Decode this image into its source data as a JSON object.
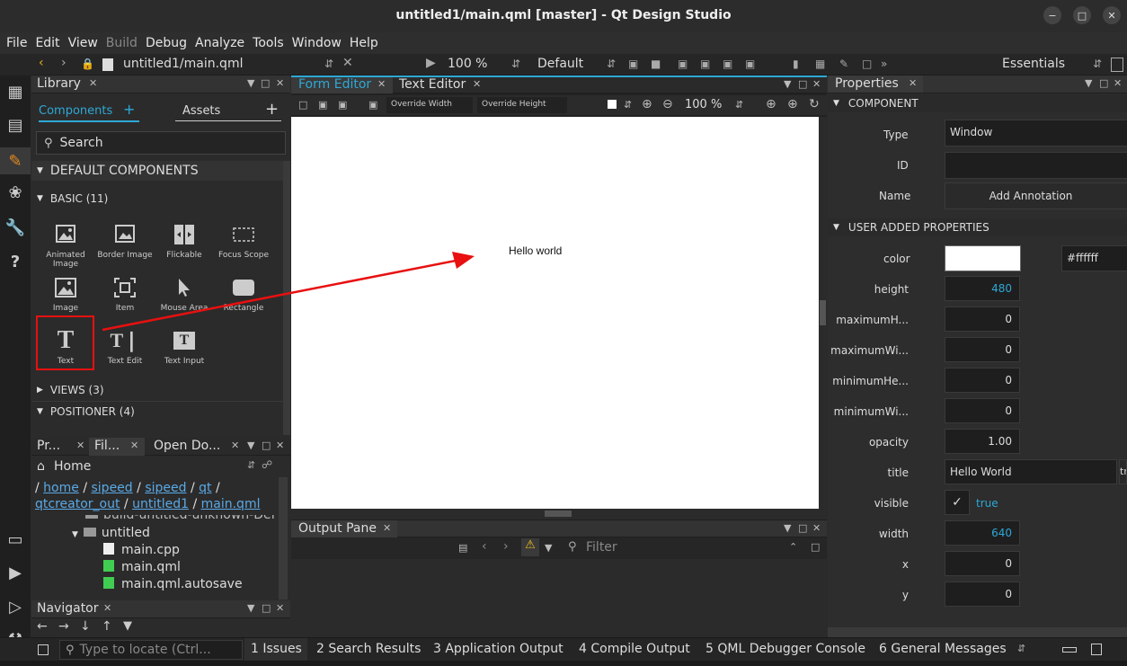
{
  "window": {
    "title": "untitled1/main.qml [master] - Qt Design Studio",
    "btn_min": "−",
    "btn_max": "□",
    "btn_close": "✕"
  },
  "menu": [
    "File",
    "Edit",
    "View",
    "Build",
    "Debug",
    "Analyze",
    "Tools",
    "Window",
    "Help"
  ],
  "toolbar": {
    "file": "untitled1/main.qml",
    "zoom": "100 %",
    "style": "Default",
    "mode": "Essentials"
  },
  "library": {
    "title": "Library",
    "tab_components": "Components",
    "tab_assets": "Assets",
    "search_placeholder": "Search",
    "section_default": "DEFAULT COMPONENTS",
    "section_basic": "BASIC (11)",
    "components": [
      "Animated Image",
      "Border Image",
      "Flickable",
      "Focus Scope",
      "Image",
      "Item",
      "Mouse Area",
      "Rectangle",
      "Text",
      "Text Edit",
      "Text Input"
    ],
    "section_views": "VIEWS (3)",
    "section_positioner": "POSITIONER (4)"
  },
  "files_pane": {
    "tabs": [
      "Pr...",
      "Fil...",
      "Open Do..."
    ],
    "location": "Home",
    "breadcrumb": [
      "home",
      "sipeed",
      "sipeed",
      "qt",
      "qtcreator_out",
      "untitled1",
      "main.qml"
    ],
    "tree": [
      "build-untitled-unknown-Def",
      "untitled",
      "main.cpp",
      "main.qml",
      "main.qml.autosave"
    ]
  },
  "navigator": {
    "title": "Navigator"
  },
  "form_editor": {
    "tab_form": "Form Editor",
    "tab_text": "Text Editor",
    "override_width": "Override Width",
    "override_height": "Override Height",
    "zoom": "100 %",
    "canvas_text": "Hello world"
  },
  "output": {
    "title": "Output Pane",
    "filter_placeholder": "Filter"
  },
  "properties": {
    "title": "Properties",
    "section_component": "COMPONENT",
    "type_label": "Type",
    "type_value": "Window",
    "id_label": "ID",
    "id_value": "",
    "name_label": "Name",
    "annotation_button": "Add Annotation",
    "section_user": "USER ADDED PROPERTIES",
    "color_label": "color",
    "color_value": "#ffffff",
    "height_label": "height",
    "height_value": "480",
    "maxh_label": "maximumH...",
    "maxh_value": "0",
    "maxw_label": "maximumWi...",
    "maxw_value": "0",
    "minh_label": "minimumHe...",
    "minh_value": "0",
    "minw_label": "minimumWi...",
    "minw_value": "0",
    "opacity_label": "opacity",
    "opacity_value": "1.00",
    "title_label": "title",
    "title_value": "Hello World",
    "title_tr": "tr",
    "visible_label": "visible",
    "visible_value": "true",
    "width_label": "width",
    "width_value": "640",
    "x_label": "x",
    "x_value": "0",
    "y_label": "y",
    "y_value": "0"
  },
  "statusbar": {
    "locate_placeholder": "Type to locate (Ctrl...",
    "items": [
      "1  Issues",
      "2  Search Results",
      "3  Application Output",
      "4  Compile Output",
      "5  QML Debugger Console",
      "6  General Messages"
    ]
  },
  "colors": {
    "accent": "#2ea8d6",
    "annotation": "#e81010",
    "link": "#5aa9e6"
  }
}
